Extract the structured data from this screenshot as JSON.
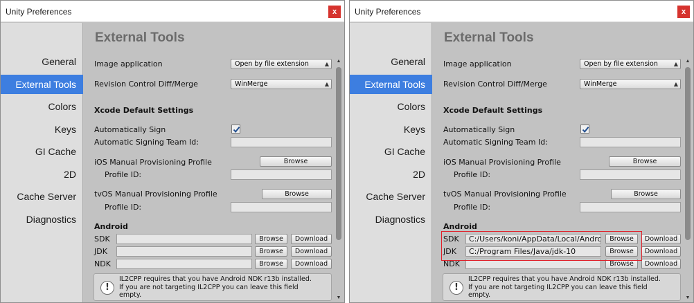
{
  "window": {
    "title": "Unity Preferences",
    "close_label": "x"
  },
  "sidebar": {
    "items": [
      {
        "label": "General",
        "selected": false
      },
      {
        "label": "External Tools",
        "selected": true
      },
      {
        "label": "Colors",
        "selected": false
      },
      {
        "label": "Keys",
        "selected": false
      },
      {
        "label": "GI Cache",
        "selected": false
      },
      {
        "label": "2D",
        "selected": false
      },
      {
        "label": "Cache Server",
        "selected": false
      },
      {
        "label": "Diagnostics",
        "selected": false
      }
    ]
  },
  "main": {
    "heading": "External Tools",
    "image_app": {
      "label": "Image application",
      "value": "Open by file extension"
    },
    "revision_control": {
      "label": "Revision Control Diff/Merge",
      "value": "WinMerge"
    },
    "xcode": {
      "heading": "Xcode Default Settings",
      "auto_sign": {
        "label": "Automatically Sign",
        "checked": true
      },
      "team_id": {
        "label": "Automatic Signing Team Id:",
        "value": ""
      },
      "ios_profile": {
        "label": "iOS Manual Provisioning Profile",
        "browse": "Browse",
        "profile_id_label": "Profile ID:",
        "profile_id": ""
      },
      "tvos_profile": {
        "label": "tvOS Manual Provisioning Profile",
        "browse": "Browse",
        "profile_id_label": "Profile ID:",
        "profile_id": ""
      }
    },
    "android": {
      "heading": "Android",
      "browse": "Browse",
      "download": "Download",
      "sdk_label": "SDK",
      "jdk_label": "JDK",
      "ndk_label": "NDK"
    },
    "help": {
      "icon": "!",
      "text": "IL2CPP requires that you have Android NDK r13b installed.\nIf you are not targeting IL2CPP you can leave this field\nempty."
    }
  },
  "windows": [
    {
      "sdk_path": "",
      "jdk_path": "",
      "ndk_path": "",
      "highlighted": false
    },
    {
      "sdk_path": "C:/Users/koni/AppData/Local/Android",
      "jdk_path": "C:/Program Files/Java/jdk-10",
      "ndk_path": "",
      "highlighted": true
    }
  ],
  "colors": {
    "selection": "#3d7ee0",
    "close_button": "#d6332e",
    "highlight_box": "#e0202a"
  },
  "icons": {
    "scroll_up": "scroll-up-icon",
    "scroll_down": "scroll-down-icon",
    "help": "warning-icon",
    "dropdown": "dropdown-arrow-icon"
  }
}
